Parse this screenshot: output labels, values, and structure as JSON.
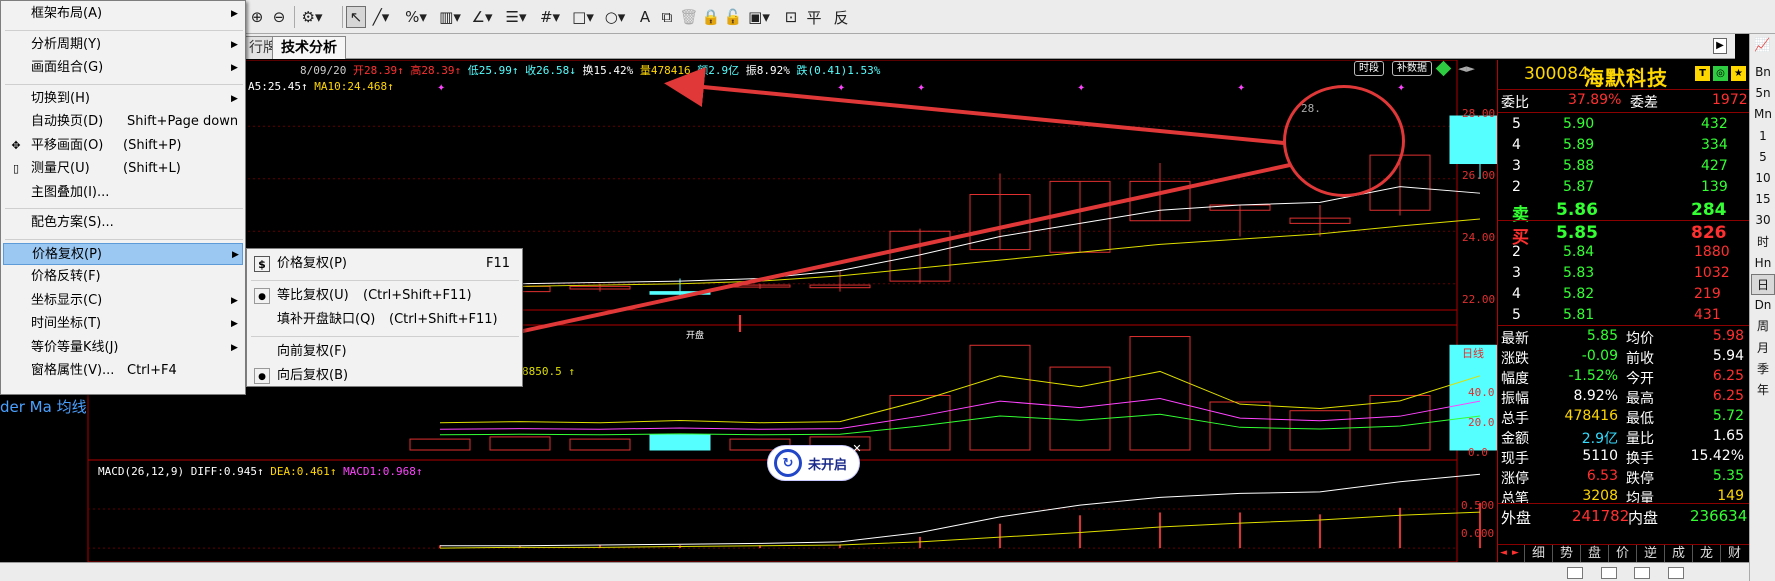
{
  "toolbar": {
    "icons": [
      "zoom-in-icon",
      "zoom-out-icon",
      "settings-icon",
      "cursor-icon",
      "line-tool-icon",
      "percent-icon",
      "channel-icon",
      "text-tool-icon",
      "fibonacci-icon",
      "grid-icon",
      "rect-icon",
      "circle-icon",
      "sign-icon",
      "copy-icon",
      "delete-icon",
      "lock-icon",
      "save-icon",
      "export-icon",
      "flat-icon",
      "mirror-icon"
    ],
    "flat_label": "平",
    "mirror_label": "反"
  },
  "tabs": [
    {
      "label": "行牌"
    },
    {
      "label": "技术分析"
    }
  ],
  "chart": {
    "ohlc": {
      "date": "8/09/20",
      "open": "开28.39",
      "high": "高28.39",
      "low": "低25.99",
      "close": "收26.58",
      "turnover": "换15.42%",
      "volume": "量478416",
      "amount": "额2.9亿",
      "amplitude": "振8.92%",
      "change": "跌(0.41)1.53%"
    },
    "ma": {
      "ma5": "A5:25.45",
      "ma10": "MA10:24.468"
    },
    "vol_text": "8850.5",
    "macd": {
      "name": "MACD(26,12,9)",
      "diff": "DIFF:0.945",
      "dea": "DEA:0.461",
      "macd": "MACD1:0.968"
    },
    "price_ticks": [
      "28.00",
      "26.00",
      "24.00",
      "22.00"
    ],
    "vol_ticks": [
      "40.0",
      "20.0",
      "0.0"
    ],
    "macd_ticks": [
      "0.500",
      "0.000"
    ],
    "line_label": "日线",
    "peak_label": "28.",
    "start_label": "开盘",
    "btn_split": "时段",
    "btn_fill": "补数据",
    "ma_label": "der Ma 均线"
  },
  "chart_data": {
    "type": "candlestick",
    "title": "",
    "xlabel": "",
    "ylabel": "",
    "ylim": [
      21.0,
      29.0
    ],
    "candles": [
      {
        "o": 21.6,
        "h": 22.3,
        "l": 21.5,
        "c": 21.7
      },
      {
        "o": 21.7,
        "h": 22.0,
        "l": 21.6,
        "c": 21.9
      },
      {
        "o": 21.8,
        "h": 22.0,
        "l": 21.7,
        "c": 21.9
      },
      {
        "o": 21.7,
        "h": 22.2,
        "l": 21.5,
        "c": 21.6
      },
      {
        "o": 21.9,
        "h": 22.0,
        "l": 21.8,
        "c": 21.95
      },
      {
        "o": 21.85,
        "h": 22.5,
        "l": 21.7,
        "c": 21.95
      },
      {
        "o": 22.1,
        "h": 24.1,
        "l": 22.0,
        "c": 24.0
      },
      {
        "o": 23.3,
        "h": 26.2,
        "l": 23.3,
        "c": 25.4
      },
      {
        "o": 23.2,
        "h": 25.9,
        "l": 23.2,
        "c": 25.9
      },
      {
        "o": 24.4,
        "h": 26.6,
        "l": 24.4,
        "c": 25.9
      },
      {
        "o": 24.8,
        "h": 25.0,
        "l": 23.8,
        "c": 25.0
      },
      {
        "o": 24.3,
        "h": 25.0,
        "l": 23.8,
        "c": 24.5
      },
      {
        "o": 24.8,
        "h": 26.9,
        "l": 24.6,
        "c": 26.9
      },
      {
        "o": 28.39,
        "h": 28.39,
        "l": 25.99,
        "c": 26.58
      }
    ],
    "ma5": [
      21.9,
      22.0,
      22.05,
      22.1,
      22.2,
      22.5,
      23.1,
      23.8,
      24.3,
      24.8,
      25.0,
      25.1,
      25.7,
      25.45
    ],
    "ma10": [
      21.8,
      21.9,
      21.95,
      22.0,
      22.1,
      22.3,
      22.6,
      22.9,
      23.2,
      23.5,
      23.7,
      23.9,
      24.2,
      24.468
    ],
    "vol": [
      5,
      6,
      5,
      7,
      5,
      6,
      25,
      48,
      38,
      52,
      22,
      18,
      25,
      48
    ],
    "macd_line": [
      0.03,
      0.03,
      0.04,
      0.05,
      0.06,
      0.08,
      0.2,
      0.4,
      0.55,
      0.65,
      0.7,
      0.72,
      0.85,
      0.945
    ],
    "dea_line": [
      0.0,
      0.01,
      0.01,
      0.02,
      0.03,
      0.04,
      0.08,
      0.14,
      0.2,
      0.27,
      0.32,
      0.36,
      0.42,
      0.461
    ],
    "macd_ylim": [
      -0.05,
      1.0
    ],
    "vol_ylim": [
      0,
      55
    ]
  },
  "stock": {
    "code": "300084",
    "name": "海默科技",
    "weibi_label": "委比",
    "weibi": "37.89%",
    "weicha_label": "委差",
    "weicha": "1972",
    "sell": [
      {
        "n": "5",
        "p": "5.90",
        "v": "432"
      },
      {
        "n": "4",
        "p": "5.89",
        "v": "334"
      },
      {
        "n": "3",
        "p": "5.88",
        "v": "427"
      },
      {
        "n": "2",
        "p": "5.87",
        "v": "139"
      },
      {
        "n": "卖",
        "p": "5.86",
        "v": "284"
      }
    ],
    "buy": [
      {
        "n": "买",
        "p": "5.85",
        "v": "826"
      },
      {
        "n": "2",
        "p": "5.84",
        "v": "1880"
      },
      {
        "n": "3",
        "p": "5.83",
        "v": "1032"
      },
      {
        "n": "4",
        "p": "5.82",
        "v": "219"
      },
      {
        "n": "5",
        "p": "5.81",
        "v": "431"
      }
    ],
    "quote": [
      {
        "l1": "最新",
        "v1": "5.85",
        "l2": "均价",
        "v2": "5.98",
        "c1": "#33ff33",
        "c2": "#ff3030"
      },
      {
        "l1": "涨跌",
        "v1": "-0.09",
        "l2": "前收",
        "v2": "5.94",
        "c1": "#33ff33",
        "c2": "#ffffff"
      },
      {
        "l1": "幅度",
        "v1": "-1.52%",
        "l2": "今开",
        "v2": "6.25",
        "c1": "#33ff33",
        "c2": "#ff3030"
      },
      {
        "l1": "振幅",
        "v1": "8.92%",
        "l2": "最高",
        "v2": "6.25",
        "c1": "#ffffff",
        "c2": "#ff3030"
      },
      {
        "l1": "总手",
        "v1": "478416",
        "l2": "最低",
        "v2": "5.72",
        "c1": "#ffd700",
        "c2": "#33ff33"
      },
      {
        "l1": "金额",
        "v1": "2.9亿",
        "l2": "量比",
        "v2": "1.65",
        "c1": "#33ddff",
        "c2": "#ffffff"
      },
      {
        "l1": "现手",
        "v1": "5110",
        "l2": "换手",
        "v2": "15.42%",
        "c1": "#ffffff",
        "c2": "#ffffff"
      },
      {
        "l1": "涨停",
        "v1": "6.53",
        "l2": "跌停",
        "v2": "5.35",
        "c1": "#ff3030",
        "c2": "#33ff33"
      },
      {
        "l1": "总笔",
        "v1": "3208",
        "l2": "均量",
        "v2": "149",
        "c1": "#ffd700",
        "c2": "#ffd700"
      }
    ],
    "outer_label": "外盘",
    "outer": "241782",
    "inner_label": "内盘",
    "inner": "236634",
    "tabs": [
      "细",
      "势",
      "盘",
      "价",
      "逆",
      "成",
      "龙",
      "财"
    ]
  },
  "sidebar": [
    "Bn",
    "5n",
    "Mn",
    "1",
    "5",
    "10",
    "15",
    "30",
    "时",
    "Hn",
    "日",
    "Dn",
    "周",
    "月",
    "季",
    "年"
  ],
  "notopen_label": "未开启",
  "menu": {
    "items": [
      {
        "label": "框架布局(A)",
        "sub": true
      },
      {
        "sep": true
      },
      {
        "label": "分析周期(Y)",
        "sub": true
      },
      {
        "label": "画面组合(G)",
        "sub": true
      },
      {
        "sep": true
      },
      {
        "label": "切换到(H)",
        "sub": true
      },
      {
        "label": "自动换页(D)",
        "sc": "Shift+Page down"
      },
      {
        "label": "平移画面(O)",
        "sc": "(Shift+P)",
        "icon": "move-icon"
      },
      {
        "label": "测量尺(U)",
        "sc": "(Shift+L)",
        "icon": "ruler-icon"
      },
      {
        "label": "主图叠加(I)..."
      },
      {
        "sep": true
      },
      {
        "label": "配色方案(S)..."
      },
      {
        "sep": true
      },
      {
        "label": "价格复权(P)",
        "sub": true,
        "hl": true
      },
      {
        "label": "价格反转(F)"
      },
      {
        "label": "坐标显示(C)",
        "sub": true
      },
      {
        "label": "时间坐标(T)",
        "sub": true
      },
      {
        "label": "等价等量K线(J)",
        "sub": true
      },
      {
        "label": "窗格属性(V)...",
        "sc": "Ctrl+F4"
      }
    ]
  },
  "submenu": {
    "items": [
      {
        "label": "价格复权(P)",
        "sc": "F11",
        "icon": "dollar-icon"
      },
      {
        "sep": true
      },
      {
        "label": "等比复权(U)",
        "sc": "(Ctrl+Shift+F11)",
        "bullet": true
      },
      {
        "label": "填补开盘缺口(Q)",
        "sc": "(Ctrl+Shift+F11)"
      },
      {
        "sep": true
      },
      {
        "label": "向前复权(F)"
      },
      {
        "label": "向后复权(B)",
        "bullet": true
      }
    ]
  },
  "colors": {
    "up": "#e03030",
    "down": "#55ffff",
    "ma5": "#ffffff",
    "ma10": "#dede00",
    "annot": "#e03838"
  }
}
